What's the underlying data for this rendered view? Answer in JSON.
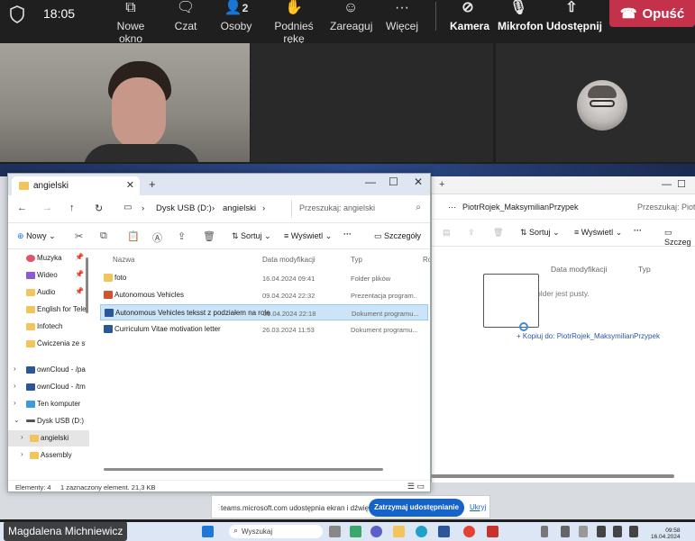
{
  "teams_bar": {
    "time": "18:05",
    "items": [
      {
        "label": "Nowe okno",
        "icon": "new-window-icon"
      },
      {
        "label": "Czat",
        "icon": "chat-icon"
      },
      {
        "label": "Osoby",
        "icon": "people-icon",
        "badge": "2"
      },
      {
        "label": "Podnieś rękę",
        "icon": "raise-hand-icon"
      },
      {
        "label": "Zareaguj",
        "icon": "reaction-icon"
      },
      {
        "label": "Więcej",
        "icon": "more-icon"
      },
      {
        "label": "Kamera",
        "icon": "camera-off-icon"
      },
      {
        "label": "Mikrofon",
        "icon": "mic-off-icon"
      },
      {
        "label": "Udostępnij",
        "icon": "share-icon"
      }
    ],
    "leave_label": "Opuść",
    "leave_color": "#c4314b"
  },
  "participant_name": "Magdalena Michniewicz",
  "explorer_left": {
    "tab_title": "angielski",
    "address": {
      "drive": "Dysk USB (D:)",
      "folder": "angielski"
    },
    "search_placeholder": "Przeszukaj: angielski",
    "toolbar": {
      "new": "Nowy",
      "sort": "Sortuj",
      "view": "Wyświetl",
      "more": "···",
      "details": "Szczegóły"
    },
    "sidebar": [
      {
        "label": "Muzyka",
        "pinned": true
      },
      {
        "label": "Wideo",
        "pinned": true
      },
      {
        "label": "Audio",
        "pinned": true
      },
      {
        "label": "English for Telec",
        "pinned": false
      },
      {
        "label": "Infotech",
        "pinned": false
      },
      {
        "label": "Ćwiczenia ze stre",
        "pinned": false
      },
      {
        "label": "ownCloud - /pa",
        "pinned": false
      },
      {
        "label": "ownCloud - /tm",
        "pinned": false
      },
      {
        "label": "Ten komputer",
        "pinned": false
      },
      {
        "label": "Dysk USB (D:)",
        "pinned": false
      },
      {
        "label": "angielski",
        "pinned": false
      },
      {
        "label": "Assembly",
        "pinned": false
      }
    ],
    "columns": {
      "name": "Nazwa",
      "date": "Data modyfikacji",
      "type": "Typ",
      "size": "Rozm"
    },
    "files": [
      {
        "name": "foto",
        "date": "16.04.2024 09:41",
        "type": "Folder plików"
      },
      {
        "name": "Autonomous Vehicles",
        "date": "09.04.2024 22:32",
        "type": "Prezentacja program..."
      },
      {
        "name": "Autonomous Vehicles teksst z podziałem na role",
        "date": "09.04.2024 22:18",
        "type": "Dokument programu..."
      },
      {
        "name": "Curriculum Vitae motivation letter",
        "date": "26.03.2024 11:53",
        "type": "Dokument programu..."
      }
    ],
    "status": {
      "count": "Elementy: 4",
      "selected": "1 zaznaczony element. 21,3 KB"
    }
  },
  "explorer_right": {
    "folder": "PiotrRojek_MaksymilianPrzypek",
    "search_placeholder": "Przeszukaj: PiotrRo",
    "toolbar": {
      "sort": "Sortuj",
      "view": "Wyświetl",
      "more": "···",
      "details": "Szczeg"
    },
    "columns": {
      "date": "Data modyfikacji",
      "type": "Typ"
    },
    "empty_msg": "older jest pusty.",
    "copy_tooltip": "+ Kopiuj do: PiotrRojek_MaksymilianPrzypek"
  },
  "share_notification": {
    "text": "teams.microsoft.com udostępnia ekran i dźwięk.",
    "stop": "Zatrzymaj udostępnianie",
    "hide": "Ukryj"
  },
  "taskbar": {
    "search": "Wyszukaj",
    "time": "09:58",
    "date": "16.04.2024"
  }
}
